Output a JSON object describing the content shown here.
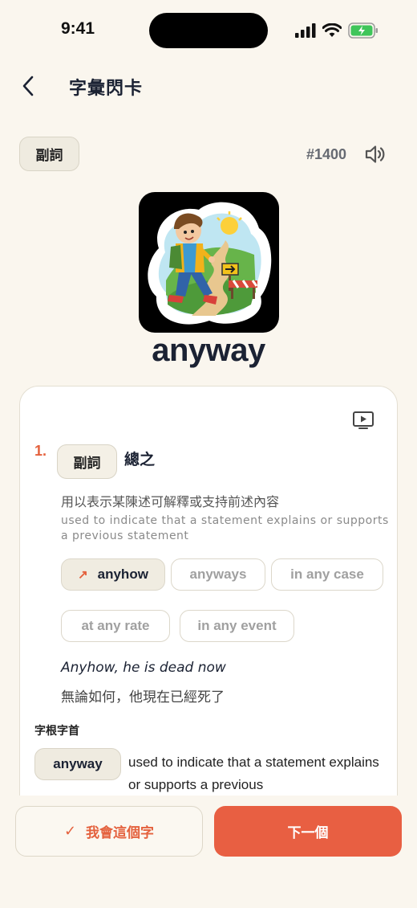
{
  "status_bar": {
    "time": "9:41",
    "battery_color": "#3fc55a"
  },
  "nav": {
    "title": "字彙閃卡",
    "back_icon": "chevron-left-icon"
  },
  "word": {
    "part_of_speech": "副詞",
    "number": "#1400",
    "headword": "anyway"
  },
  "definition": {
    "index": "1.",
    "part_of_speech": "副詞",
    "gloss": "總之",
    "description_zh": "用以表示某陳述可解釋或支持前述內容",
    "description_en": "used to indicate that a statement explains or supports a previous statement",
    "synonyms": [
      {
        "label": "anyhow",
        "active": true
      },
      {
        "label": "anyways",
        "active": false
      },
      {
        "label": "in any case",
        "active": false
      },
      {
        "label": "at any rate",
        "active": false
      },
      {
        "label": "in any event",
        "active": false
      }
    ],
    "example_en": "Anyhow, he is dead now",
    "example_zh": "無論如何，他現在已經死了"
  },
  "roots": {
    "label": "字根字首",
    "word": "anyway",
    "definition": "used to indicate that a statement explains or supports a previous"
  },
  "actions": {
    "know_label": "我會這個字",
    "next_label": "下一個"
  },
  "colors": {
    "accent": "#e85f42",
    "background": "#faf6ee"
  }
}
